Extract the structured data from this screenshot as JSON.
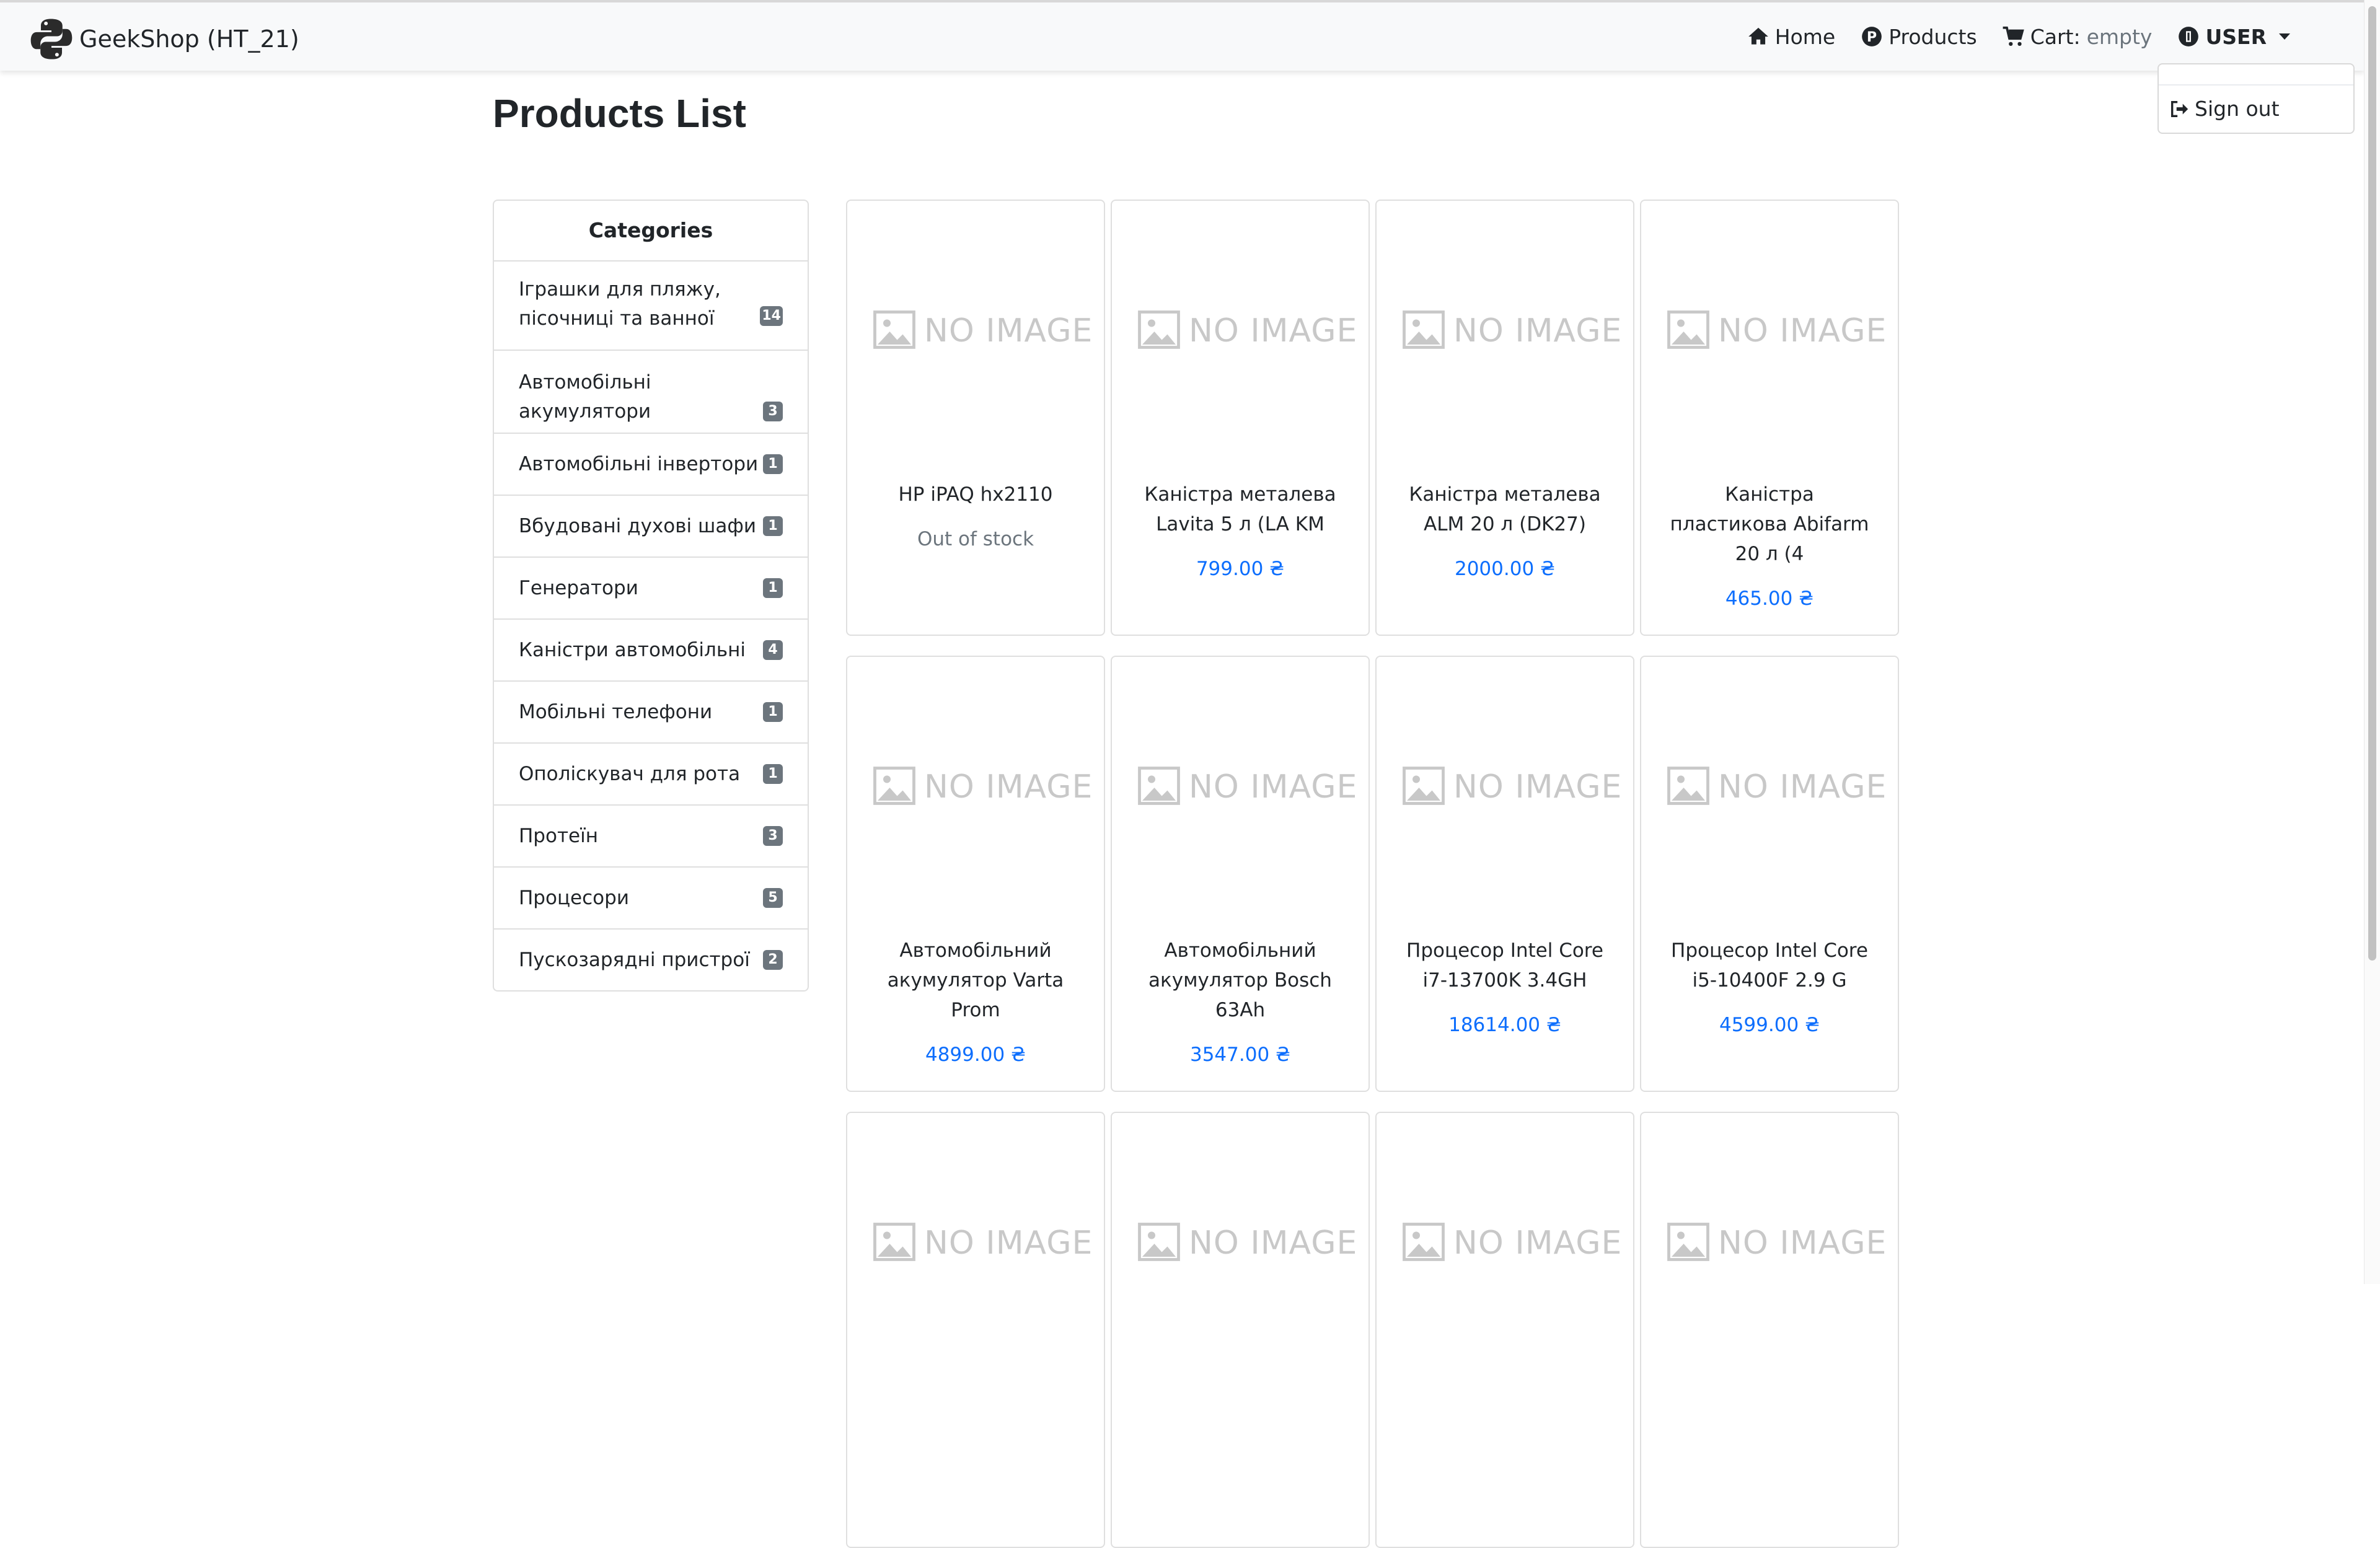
{
  "navbar": {
    "brand": "GeekShop (HT_21)",
    "home": "Home",
    "products": "Products",
    "cart_label": "Cart:",
    "cart_value": "empty",
    "user": "USER"
  },
  "dropdown": {
    "sign_out": "Sign out"
  },
  "page": {
    "title": "Products List"
  },
  "categories": {
    "header": "Categories",
    "items": [
      {
        "label": "Іграшки для пляжу, пісочниці та ванної",
        "count": "14"
      },
      {
        "label": "Автомобільні акумулятори",
        "count": "3"
      },
      {
        "label": "Автомобільні інвертори",
        "count": "1"
      },
      {
        "label": "Вбудовані духові шафи",
        "count": "1"
      },
      {
        "label": "Генератори",
        "count": "1"
      },
      {
        "label": "Каністри автомобільні",
        "count": "4"
      },
      {
        "label": "Мобільні телефони",
        "count": "1"
      },
      {
        "label": "Ополіскувач для рота",
        "count": "1"
      },
      {
        "label": "Протеїн",
        "count": "3"
      },
      {
        "label": "Процесори",
        "count": "5"
      },
      {
        "label": "Пускозарядні пристрої",
        "count": "2"
      }
    ]
  },
  "products": {
    "no_image_text": "NO IMAGE",
    "items": [
      {
        "title": "HP iPAQ hx2110",
        "price": "Out of stock"
      },
      {
        "title": "Каністра металева Lavita 5 л (LA KM",
        "price": "799.00 ₴"
      },
      {
        "title": "Каністра металева ALM 20 л (DK27)",
        "price": "2000.00 ₴"
      },
      {
        "title": "Каністра пластикова Abifarm 20 л (4",
        "price": "465.00 ₴"
      },
      {
        "title": "Автомобільний акумулятор Varta Prom",
        "price": "4899.00 ₴"
      },
      {
        "title": "Автомобільний акумулятор Bosch 63Ah",
        "price": "3547.00 ₴"
      },
      {
        "title": "Процесор Intel Core i7-13700K 3.4GH",
        "price": "18614.00 ₴"
      },
      {
        "title": "Процесор Intel Core i5-10400F 2.9 G",
        "price": "4599.00 ₴"
      },
      {
        "title": "",
        "price": ""
      },
      {
        "title": "",
        "price": ""
      },
      {
        "title": "",
        "price": ""
      },
      {
        "title": "",
        "price": ""
      }
    ]
  },
  "colors": {
    "link": "#0d6efd",
    "muted": "#6c757d",
    "badge": "#6c757d",
    "navbar_bg": "#f8f9fa"
  }
}
